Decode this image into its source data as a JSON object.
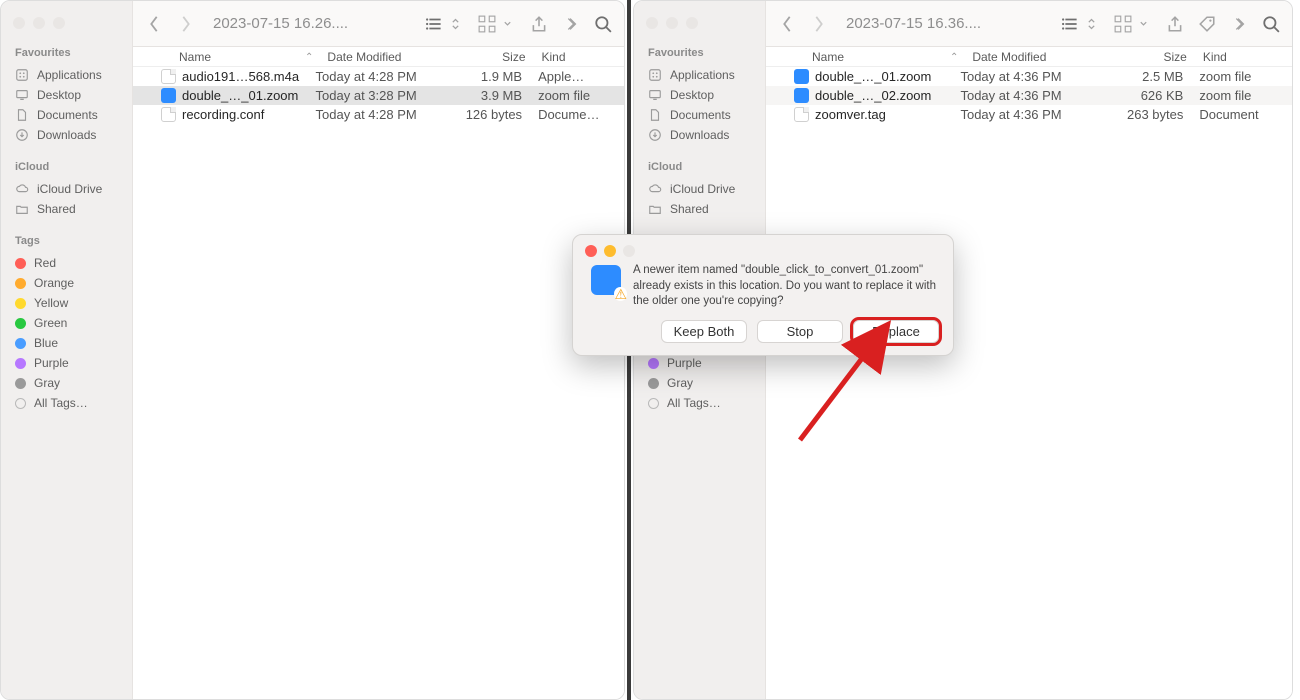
{
  "sidebar": {
    "favourites_heading": "Favourites",
    "favourites": [
      {
        "label": "Applications",
        "icon": "applications"
      },
      {
        "label": "Desktop",
        "icon": "desktop"
      },
      {
        "label": "Documents",
        "icon": "documents"
      },
      {
        "label": "Downloads",
        "icon": "downloads"
      }
    ],
    "icloud_heading": "iCloud",
    "icloud": [
      {
        "label": "iCloud Drive",
        "icon": "cloud"
      },
      {
        "label": "Shared",
        "icon": "shared"
      }
    ],
    "tags_heading": "Tags",
    "tags": [
      {
        "label": "Red",
        "color": "#ff5f57"
      },
      {
        "label": "Orange",
        "color": "#ffab2e"
      },
      {
        "label": "Yellow",
        "color": "#ffd92e"
      },
      {
        "label": "Green",
        "color": "#28c840"
      },
      {
        "label": "Blue",
        "color": "#4a9dff"
      },
      {
        "label": "Purple",
        "color": "#b678ff"
      },
      {
        "label": "Gray",
        "color": "#9a9a9a"
      }
    ],
    "all_tags_label": "All Tags…"
  },
  "columns": {
    "name": "Name",
    "date": "Date Modified",
    "size": "Size",
    "kind": "Kind"
  },
  "windows": {
    "left": {
      "title": "2023-07-15 16.26....",
      "files": [
        {
          "name": "audio191…568.m4a",
          "date": "Today at 4:28 PM",
          "size": "1.9 MB",
          "kind": "Apple…",
          "icon": "doc",
          "selected": false
        },
        {
          "name": "double_…_01.zoom",
          "date": "Today at 3:28 PM",
          "size": "3.9 MB",
          "kind": "zoom file",
          "icon": "zoom",
          "selected": true
        },
        {
          "name": "recording.conf",
          "date": "Today at 4:28 PM",
          "size": "126 bytes",
          "kind": "Docume…",
          "icon": "doc",
          "selected": false
        }
      ]
    },
    "right": {
      "title": "2023-07-15 16.36....",
      "files": [
        {
          "name": "double_…_01.zoom",
          "date": "Today at 4:36 PM",
          "size": "2.5 MB",
          "kind": "zoom file",
          "icon": "zoom"
        },
        {
          "name": "double_…_02.zoom",
          "date": "Today at 4:36 PM",
          "size": "626 KB",
          "kind": "zoom file",
          "icon": "zoom"
        },
        {
          "name": "zoomver.tag",
          "date": "Today at 4:36 PM",
          "size": "263 bytes",
          "kind": "Document",
          "icon": "doc"
        }
      ]
    }
  },
  "dialog": {
    "message": "A newer item named \"double_click_to_convert_01.zoom\" already exists in this location. Do you want to replace it with the older one you're copying?",
    "buttons": {
      "keep_both": "Keep Both",
      "stop": "Stop",
      "replace": "Replace"
    }
  }
}
